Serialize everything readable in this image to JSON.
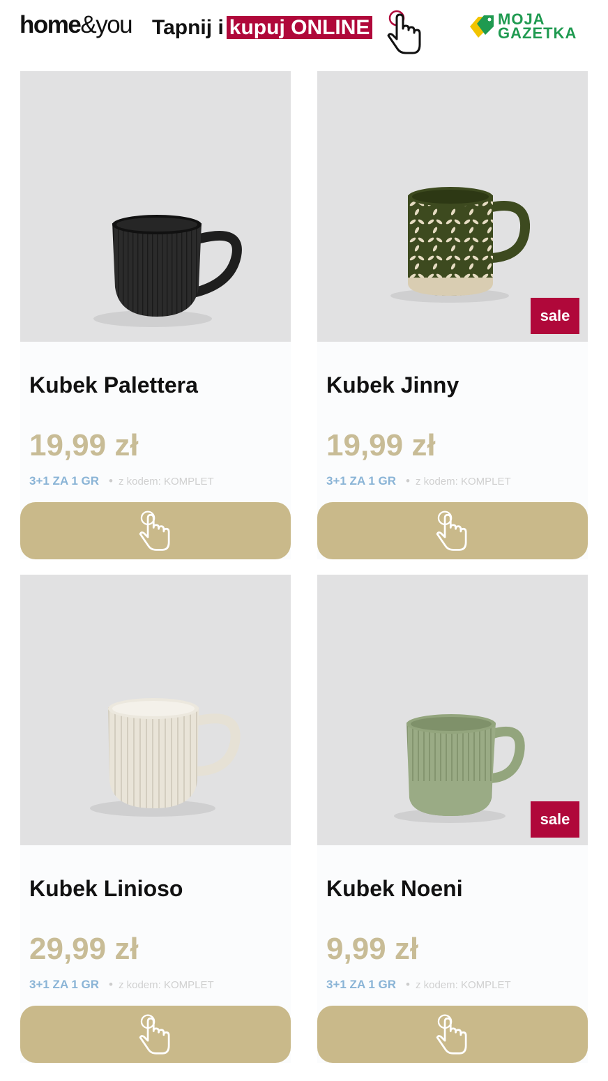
{
  "header": {
    "brand_bold": "home",
    "brand_light": "&you",
    "tap_text": "Tapnij i",
    "tap_highlight": "kupuj ONLINE",
    "tap_icon": "hand-pointer-icon",
    "partner_line1": "MOJA",
    "partner_line2": "GAZETKA",
    "partner_icon": "tag-icon"
  },
  "colors": {
    "accent_red": "#b0083a",
    "price_gold": "#c8bc96",
    "button_gold": "#c9b98a",
    "promo_blue": "#8ab4d6",
    "partner_green": "#1f9a50"
  },
  "products": [
    {
      "name": "Kubek Palettera",
      "price": "19,99 zł",
      "deal": "3+1 ZA 1 GR",
      "code": "z kodem: KOMPLET",
      "sale": "",
      "mug": "black mug"
    },
    {
      "name": "Kubek Jinny",
      "price": "19,99 zł",
      "deal": "3+1 ZA 1 GR",
      "code": "z kodem: KOMPLET",
      "sale": "sale",
      "mug": "green leaf-pattern mug"
    },
    {
      "name": "Kubek Linioso",
      "price": "29,99 zł",
      "deal": "3+1 ZA 1 GR",
      "code": "z kodem: KOMPLET",
      "sale": "",
      "mug": "cream ribbed mug"
    },
    {
      "name": "Kubek Noeni",
      "price": "9,99 zł",
      "deal": "3+1 ZA 1 GR",
      "code": "z kodem: KOMPLET",
      "sale": "sale",
      "mug": "sage ribbed mug"
    }
  ],
  "button_icon": "hand-pointer-icon"
}
